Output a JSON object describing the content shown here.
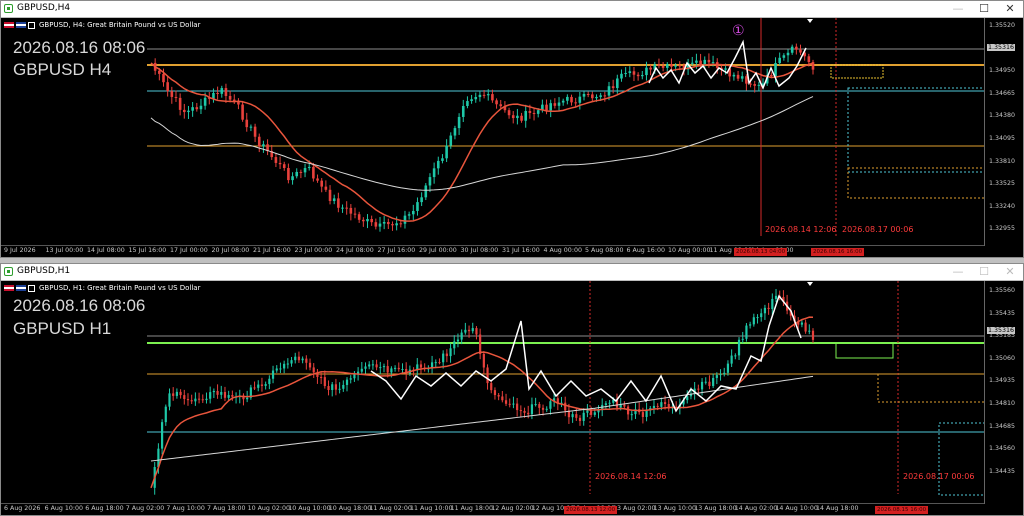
{
  "top": {
    "window_title": "GBPUSD,H4",
    "symbol_info": "GBPUSD, H4:  Great Britain Pound vs US Dollar",
    "datetime_overlay": "2026.08.16 08:06",
    "symbol_overlay": "GBPUSD H4",
    "circle_marker": "①",
    "current_price": "1.35316",
    "price_labels": [
      "1.35520",
      "1.35235",
      "1.34950",
      "1.34665",
      "1.34380",
      "1.34095",
      "1.33810",
      "1.33525",
      "1.33240",
      "1.32955"
    ],
    "time_labels": [
      "9 Jul 2026",
      "13 Jul 00:00",
      "14 Jul 08:00",
      "15 Jul 16:00",
      "17 Jul 00:00",
      "20 Jul 08:00",
      "21 Jul 16:00",
      "23 Jul 00:00",
      "24 Jul 08:00",
      "27 Jul 16:00",
      "29 Jul 00:00",
      "30 Jul 08:00",
      "31 Jul 16:00",
      "4 Aug 00:00",
      "5 Aug 08:00",
      "6 Aug 16:00",
      "10 Aug 00:00",
      "11 Aug 08:00",
      "14 Aug 00:00"
    ],
    "vline_label_1": "2026.08.14 12:06",
    "vline_label_2": "2026.08.17 00:06",
    "red_tag_1": "2026.08.13 04:00",
    "red_tag_2": "2026.08.16 16:00"
  },
  "bottom": {
    "window_title": "GBPUSD,H1",
    "symbol_info": "GBPUSD, H1:  Great Britain Pound vs US Dollar",
    "datetime_overlay": "2026.08.16 08:06",
    "symbol_overlay": "GBPUSD H1",
    "current_price": "1.35316",
    "price_labels": [
      "1.35560",
      "1.35435",
      "1.35185",
      "1.35060",
      "1.34935",
      "1.34810",
      "1.34685",
      "1.34560",
      "1.34435"
    ],
    "time_labels": [
      "6 Aug 2026",
      "6 Aug 10:00",
      "6 Aug 18:00",
      "7 Aug 02:00",
      "7 Aug 10:00",
      "7 Aug 18:00",
      "10 Aug 02:00",
      "10 Aug 10:00",
      "10 Aug 18:00",
      "11 Aug 02:00",
      "11 Aug 10:00",
      "11 Aug 18:00",
      "12 Aug 02:00",
      "12 Aug 10:00",
      "12 Aug 18:00",
      "13 Aug 02:00",
      "13 Aug 10:00",
      "13 Aug 18:00",
      "14 Aug 02:00",
      "14 Aug 10:00",
      "14 Aug 18:00"
    ],
    "vline_label_1": "2026.08.14 12:06",
    "vline_label_2": "2026.08.17 00:06",
    "red_tag_1": "2026.08.13 12:00",
    "red_tag_2": "2026.08.15 16:00"
  },
  "window_buttons": {
    "minimize": "—",
    "restore": "☐",
    "close": "✕"
  },
  "colors": {
    "bull": "#1ec8a8",
    "bear": "#e8413c",
    "ma_fast": "#e8553c",
    "ma_slow": "#d8d8d8",
    "level_orange": "#e0a030",
    "level_cyan": "#4fc8d8",
    "level_green": "#7cf050",
    "vline_red": "#d42a2a",
    "zigzag": "#ffffff"
  }
}
